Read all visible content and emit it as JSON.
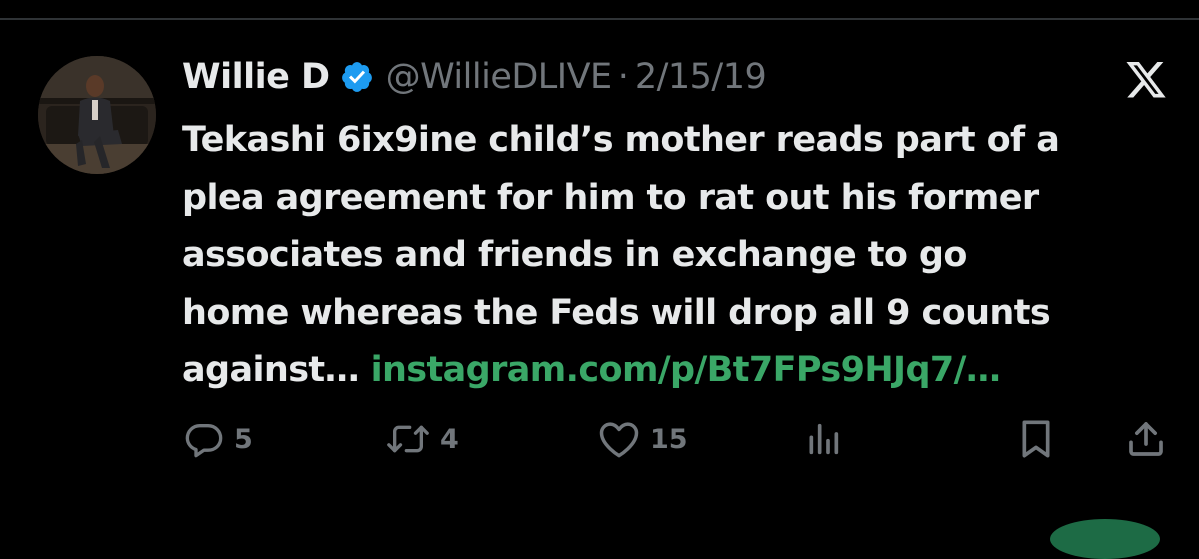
{
  "tweet": {
    "author_name": "Willie D",
    "handle": "@WillieDLIVE",
    "separator": "·",
    "date": "2/15/19",
    "text_lines": [
      "Tekashi 6ix9ine child’s mother  reads part of a",
      "plea agreement for him to rat out his former",
      "associates and friends in exchange to go",
      "home whereas the Feds will drop all 9 counts"
    ],
    "text_last_prefix": "against… ",
    "link_text": "instagram.com/p/Bt7FPs9HJq7/…"
  },
  "actions": {
    "reply_count": "5",
    "retweet_count": "4",
    "like_count": "15"
  },
  "icons": {
    "verified": "verified-badge-icon",
    "brand": "x-logo-icon",
    "reply": "reply-icon",
    "retweet": "retweet-icon",
    "like": "heart-icon",
    "views": "views-icon",
    "bookmark": "bookmark-icon",
    "share": "share-icon"
  },
  "colors": {
    "background": "#000000",
    "text": "#e7e9ea",
    "muted": "#71767b",
    "link": "#3aa767",
    "verified": "#1d9bf0"
  }
}
